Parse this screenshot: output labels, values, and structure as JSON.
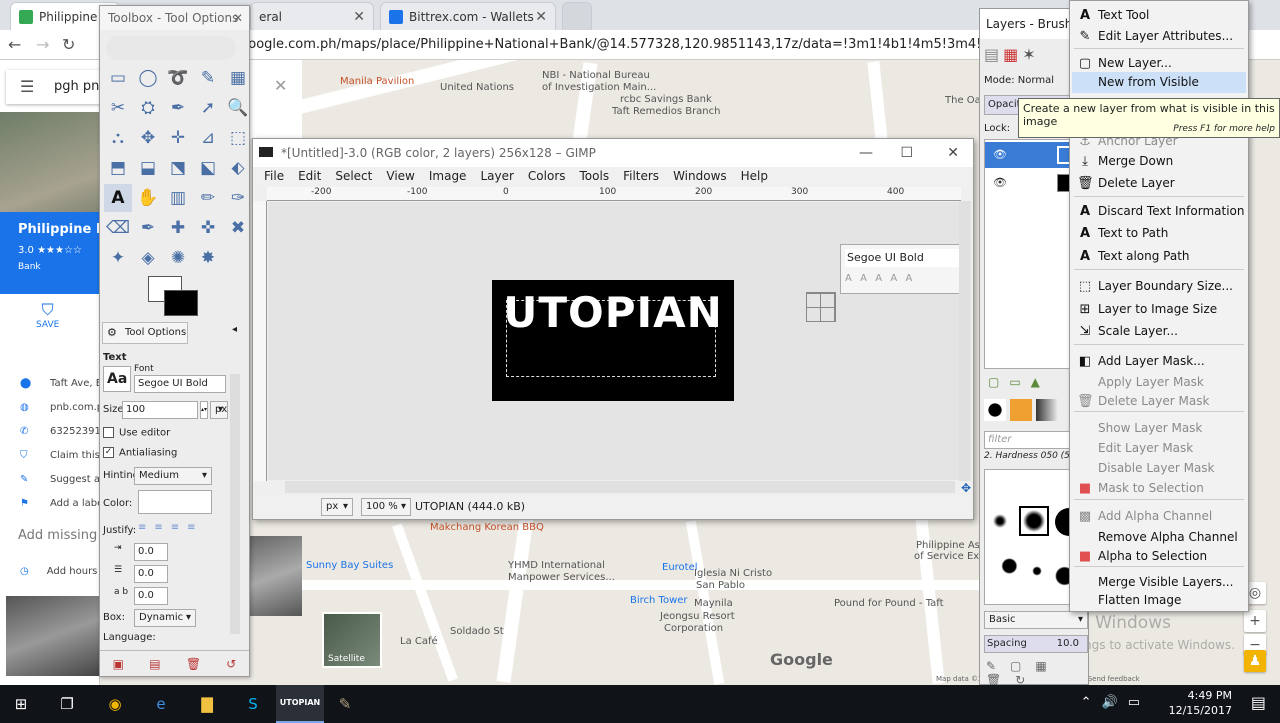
{
  "browser": {
    "tabs": [
      {
        "title": "Philippine N",
        "color": "#34a853"
      },
      {
        "title": "eral",
        "color": "#888888"
      },
      {
        "title": "Bittrex.com - Wallets",
        "color": "#1a73e8"
      }
    ],
    "url": "google.com.ph/maps/place/Philippine+National+Bank/@14.577328,120.9851143,17z/data=!3m1!4b1!4m5!3m4!1s0x3397ca282"
  },
  "maps_panel": {
    "search_value": "pgh pnb",
    "place_name": "Philippine Na",
    "rating": "3.0 ★★★☆☆",
    "type": "Bank",
    "save_label": "SAVE",
    "details": [
      {
        "icon": "location-pin-icon",
        "glyph": "⬤",
        "text": "Taft Ave, E"
      },
      {
        "icon": "globe-icon",
        "glyph": "◍",
        "text": "pnb.com.p"
      },
      {
        "icon": "phone-icon",
        "glyph": "✆",
        "text": "63252391"
      },
      {
        "icon": "shield-icon",
        "glyph": "⛉",
        "text": "Claim this"
      },
      {
        "icon": "pencil-icon",
        "glyph": "✎",
        "text": "Suggest a"
      },
      {
        "icon": "flag-icon",
        "glyph": "⚑",
        "text": "Add a labe"
      }
    ],
    "add_missing": "Add missing i",
    "add_hours": "Add hours"
  },
  "map": {
    "labels": [
      {
        "text": "Manila Pavilion",
        "cls": "poi poi-o"
      },
      {
        "text": "NBI - National Bureau",
        "cls": "maplabel"
      },
      {
        "text": "of Investigation Main...",
        "cls": "maplabel"
      },
      {
        "text": "rcbc Savings Bank",
        "cls": "maplabel"
      },
      {
        "text": "Taft Remedios Branch",
        "cls": "maplabel"
      },
      {
        "text": "United Nations",
        "cls": "maplabel"
      },
      {
        "text": "The Oa",
        "cls": "maplabel"
      },
      {
        "text": "Makchang Korean BBQ",
        "cls": "poi poi-o"
      },
      {
        "text": "Sunny Bay Suites",
        "cls": "poi"
      },
      {
        "text": "YHMD International",
        "cls": "maplabel"
      },
      {
        "text": "Manpower Services...",
        "cls": "maplabel"
      },
      {
        "text": "Eurotel",
        "cls": "poi"
      },
      {
        "text": "Iglesia Ni Cristo",
        "cls": "maplabel"
      },
      {
        "text": "San Pablo",
        "cls": "maplabel"
      },
      {
        "text": "Maynila",
        "cls": "maplabel"
      },
      {
        "text": "Birch Tower",
        "cls": "poi"
      },
      {
        "text": "Philippine Asso",
        "cls": "maplabel"
      },
      {
        "text": "of Service Expo",
        "cls": "maplabel"
      },
      {
        "text": "Pound for Pound - Taft",
        "cls": "maplabel"
      },
      {
        "text": "Jeongsu Resort",
        "cls": "maplabel"
      },
      {
        "text": "Corporation",
        "cls": "maplabel"
      },
      {
        "text": "La Café",
        "cls": "maplabel"
      },
      {
        "text": "Soldado St",
        "cls": "maplabel"
      }
    ],
    "satellite_label": "Satellite",
    "google_logo": "Google",
    "activate_title": "Activate Windows",
    "activate_sub": "Go to Settings to activate Windows.",
    "footer": "Map data ©2017 Google   Philippines   Terms   Send feedback"
  },
  "toolbox": {
    "title": "Toolbox - Tool Options",
    "tools": [
      "▭",
      "◯",
      "➰",
      "✎",
      "▦",
      "✂",
      "⛭",
      "✒",
      "➚",
      "🔍",
      "⛬",
      "✥",
      "✛",
      "⊿",
      "⬚",
      "⬒",
      "⬓",
      "⬔",
      "⬕",
      "⬖",
      "A",
      "✋",
      "▥",
      "✏",
      "✑",
      "⌫",
      "✒",
      "✚",
      "✜",
      "✖",
      "✦",
      "◈",
      "✺",
      "✸"
    ],
    "tool_options_tab": "Tool Options",
    "section": "Text",
    "font_label": "Font",
    "font_value": "Segoe UI Bold",
    "font_preview": "Aa",
    "size_label": "Size:",
    "size_value": "100",
    "size_unit": "px",
    "use_editor": "Use editor",
    "antialiasing": "Antialiasing",
    "hinting_label": "Hinting:",
    "hinting_value": "Medium",
    "color_label": "Color:",
    "justify_label": "Justify:",
    "indent_value": "0.0",
    "line_spacing_value": "0.0",
    "letter_spacing_value": "0.0",
    "box_label": "Box:",
    "box_value": "Dynamic",
    "language_label": "Language:"
  },
  "image_window": {
    "title": "*[Untitled]-3.0 (RGB color, 2 layers) 256x128 – GIMP",
    "menu": [
      "File",
      "Edit",
      "Select",
      "View",
      "Image",
      "Layer",
      "Colors",
      "Tools",
      "Filters",
      "Windows",
      "Help"
    ],
    "ruler_ticks": [
      "-200",
      "-100",
      "0",
      "100",
      "200",
      "300",
      "400"
    ],
    "image_text": "UTOPIAN",
    "font_box_value": "Segoe UI Bold",
    "unit": "px",
    "zoom": "100 %",
    "status": "UTOPIAN (444.0 kB)"
  },
  "layers_dock": {
    "title": "Layers - Brushes",
    "mode_label": "Mode: Normal",
    "opacity_label": "Opacity",
    "lock_label": "Lock:",
    "filter_placeholder": "filter",
    "brush_name": "2. Hardness 050 (51 ×",
    "brush_preset": "Basic",
    "spacing_label": "Spacing",
    "spacing_value": "10.0"
  },
  "context_menu": {
    "items": [
      {
        "label": "Text Tool",
        "icon": "text-tool-icon",
        "glyph": "A",
        "state": "normal"
      },
      {
        "label": "Edit Layer Attributes...",
        "icon": "edit-icon",
        "glyph": "✎",
        "state": "normal"
      },
      {
        "label": "New Layer...",
        "icon": "new-layer-icon",
        "glyph": "▢",
        "state": "normal"
      },
      {
        "label": "New from Visible",
        "icon": "",
        "glyph": "",
        "state": "highlight"
      },
      {
        "label": "Anchor Layer",
        "icon": "anchor-icon",
        "glyph": "⚓",
        "state": "disabled"
      },
      {
        "label": "Merge Down",
        "icon": "merge-down-icon",
        "glyph": "⤓",
        "state": "normal"
      },
      {
        "label": "Delete Layer",
        "icon": "trash-icon",
        "glyph": "🗑",
        "state": "normal"
      },
      {
        "label": "Discard Text Information",
        "icon": "text-icon",
        "glyph": "A",
        "state": "normal"
      },
      {
        "label": "Text to Path",
        "icon": "text-path-icon",
        "glyph": "A",
        "state": "normal"
      },
      {
        "label": "Text along Path",
        "icon": "text-along-icon",
        "glyph": "A",
        "state": "normal"
      },
      {
        "label": "Layer Boundary Size...",
        "icon": "boundary-icon",
        "glyph": "⬚",
        "state": "normal"
      },
      {
        "label": "Layer to Image Size",
        "icon": "layer-image-icon",
        "glyph": "⊞",
        "state": "normal"
      },
      {
        "label": "Scale Layer...",
        "icon": "scale-icon",
        "glyph": "⇲",
        "state": "normal"
      },
      {
        "label": "Add Layer Mask...",
        "icon": "mask-add-icon",
        "glyph": "◧",
        "state": "normal"
      },
      {
        "label": "Apply Layer Mask",
        "icon": "",
        "glyph": "",
        "state": "disabled"
      },
      {
        "label": "Delete Layer Mask",
        "icon": "trash-icon",
        "glyph": "🗑",
        "state": "disabled"
      },
      {
        "label": "Show Layer Mask",
        "icon": "",
        "glyph": "",
        "state": "disabled"
      },
      {
        "label": "Edit Layer Mask",
        "icon": "",
        "glyph": "",
        "state": "disabled"
      },
      {
        "label": "Disable Layer Mask",
        "icon": "",
        "glyph": "",
        "state": "disabled"
      },
      {
        "label": "Mask to Selection",
        "icon": "mask-select-icon",
        "glyph": "■",
        "state": "disabled"
      },
      {
        "label": "Add Alpha Channel",
        "icon": "alpha-icon",
        "glyph": "▩",
        "state": "disabled"
      },
      {
        "label": "Remove Alpha Channel",
        "icon": "",
        "glyph": "",
        "state": "normal"
      },
      {
        "label": "Alpha to Selection",
        "icon": "alpha-select-icon",
        "glyph": "■",
        "state": "normal"
      },
      {
        "label": "Merge Visible Layers...",
        "icon": "",
        "glyph": "",
        "state": "normal"
      },
      {
        "label": "Flatten Image",
        "icon": "",
        "glyph": "",
        "state": "normal"
      }
    ],
    "tooltip": "Create a new layer from what is visible in this image",
    "tooltip_sub": "Press F1 for more help"
  },
  "taskbar": {
    "apps": [
      {
        "name": "windows-start-icon",
        "glyph": "⊞",
        "color": "#ffffff"
      },
      {
        "name": "task-view-icon",
        "glyph": "❐",
        "color": "#ffffff"
      },
      {
        "name": "chrome-icon",
        "glyph": "◉",
        "color": "#f2b705"
      },
      {
        "name": "edge-icon",
        "glyph": "e",
        "color": "#3d8ee6"
      },
      {
        "name": "file-explorer-icon",
        "glyph": "▇",
        "color": "#f0c040"
      },
      {
        "name": "skype-icon",
        "glyph": "S",
        "color": "#00aff0"
      },
      {
        "name": "gimp-icon",
        "glyph": "✎",
        "color": "#b0a080"
      }
    ],
    "active_window": "UTOPIAN",
    "time": "4:49 PM",
    "date": "12/15/2017"
  }
}
